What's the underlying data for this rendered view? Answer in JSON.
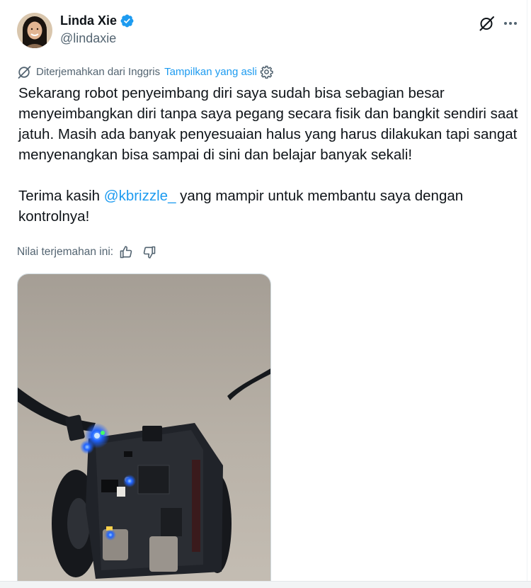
{
  "author": {
    "display_name": "Linda Xie",
    "handle": "@lindaxie"
  },
  "icons": {
    "verified": "verified-badge-icon",
    "grok": "grok-icon",
    "more": "more-horizontal-icon",
    "translate": "translate-icon",
    "settings": "gear-icon",
    "thumbs_up": "thumbs-up-icon",
    "thumbs_down": "thumbs-down-icon"
  },
  "colors": {
    "accent": "#1d9bf0",
    "text_primary": "#0f1419",
    "text_secondary": "#536471"
  },
  "translation": {
    "label": "Diterjemahkan dari Inggris",
    "show_original": "Tampilkan yang asli"
  },
  "tweet": {
    "paragraph1": "Sekarang robot penyeimbang diri saya sudah bisa sebagian besar menyeimbangkan diri tanpa saya pegang secara fisik dan bangkit sendiri saat jatuh. Masih ada banyak penyesuaian halus yang harus dilakukan tapi sangat menyenangkan bisa sampai di sini dan belajar banyak sekali!",
    "paragraph2_prefix": "Terima kasih ",
    "mention": "@kbrizzle_",
    "paragraph2_suffix": " yang mampir untuk membantu saya dengan kontrolnya!"
  },
  "rating": {
    "label": "Nilai terjemahan ini:"
  }
}
